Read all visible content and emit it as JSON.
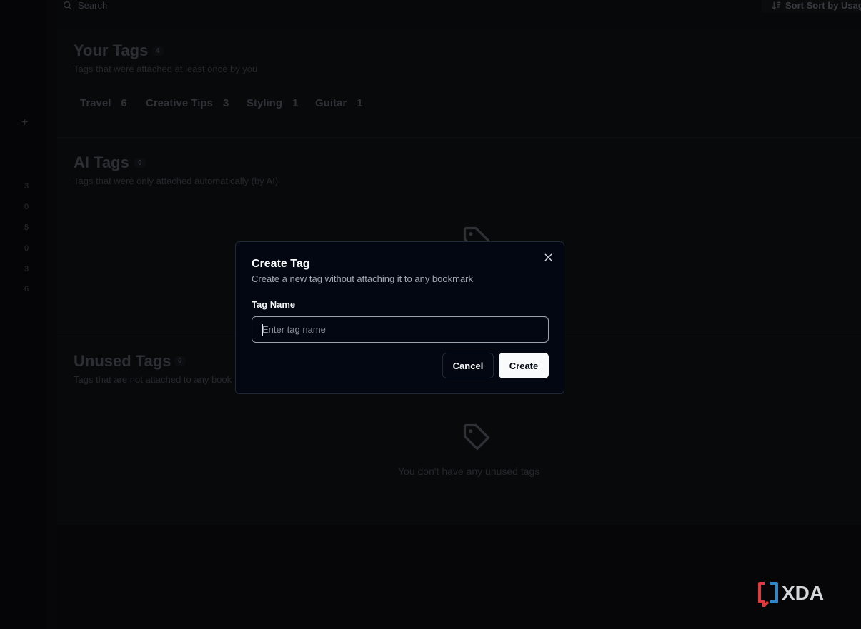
{
  "topbar": {
    "search_placeholder": "Search",
    "sort_label": "Sort Sort by Usag"
  },
  "sidebar": {
    "counts": [
      "3",
      "0",
      "5",
      "0",
      "3",
      "6"
    ]
  },
  "your_tags": {
    "title": "Your Tags",
    "count": "4",
    "subtitle": "Tags that were attached at least once by you",
    "tags": [
      {
        "name": "Travel",
        "count": "6"
      },
      {
        "name": "Creative Tips",
        "count": "3"
      },
      {
        "name": "Styling",
        "count": "1"
      },
      {
        "name": "Guitar",
        "count": "1"
      }
    ]
  },
  "ai_tags": {
    "title": "AI Tags",
    "count": "0",
    "subtitle": "Tags that were only attached automatically (by AI)"
  },
  "unused_tags": {
    "title": "Unused Tags",
    "count": "0",
    "subtitle": "Tags that are not attached to any book",
    "empty_text": "You don't have any unused tags"
  },
  "modal": {
    "title": "Create Tag",
    "description": "Create a new tag without attaching it to any bookmark",
    "field_label": "Tag Name",
    "input_placeholder": "Enter tag name",
    "input_value": "",
    "cancel_label": "Cancel",
    "create_label": "Create"
  },
  "watermark": {
    "text": "XDA"
  },
  "colors": {
    "modal_bg": "#030712",
    "primary_button": "#f9fafb",
    "watermark_red": "#e03a3e",
    "watermark_blue": "#2e87c8"
  }
}
